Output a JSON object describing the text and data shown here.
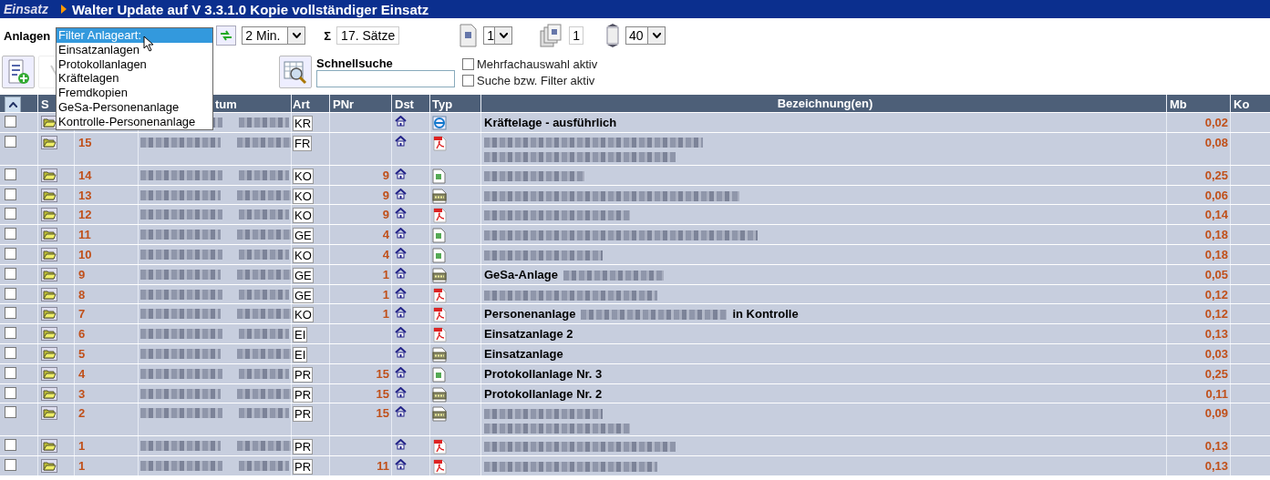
{
  "title_bar": {
    "app": "Einsatz",
    "title": "Walter Update auf V 3.3.1.0 Kopie vollständiger Einsatz"
  },
  "toolbar": {
    "label": "Anlagen",
    "interval": "2 Min.",
    "sigma": "Σ",
    "records": "17. Sätze",
    "page": "1",
    "copies": "1",
    "page_size": "40"
  },
  "filter_dropdown": [
    {
      "label": "Filter Anlageart:",
      "selected": true
    },
    {
      "label": "Einsatzanlagen",
      "selected": false
    },
    {
      "label": "Protokollanlagen",
      "selected": false
    },
    {
      "label": "Kräftelagen",
      "selected": false
    },
    {
      "label": "Fremdkopien",
      "selected": false
    },
    {
      "label": "GeSa-Personenanlage",
      "selected": false
    },
    {
      "label": "Kontrolle-Personenanlage",
      "selected": false
    }
  ],
  "search": {
    "label": "Schnellsuche",
    "options": [
      {
        "label": "Mehrfachauswahl aktiv",
        "checked": false
      },
      {
        "label": "Suche bzw. Filter aktiv",
        "checked": false
      }
    ]
  },
  "table": {
    "columns": [
      "S",
      "tum",
      "Art",
      "PNr",
      "Dst",
      "Typ",
      "Bezeichnung(en)",
      "Mb",
      "Ko"
    ],
    "rows": [
      {
        "checked": false,
        "art": "KR",
        "kind": "web",
        "desc": [
          [
            {
              "kind": "text",
              "text": "Kräftelage - ausführlich"
            }
          ]
        ],
        "mb": "0,02"
      },
      {
        "checked": false,
        "num": "15",
        "art": "FR",
        "kind": "pdf",
        "desc": [
          [
            {
              "kind": "blur"
            }
          ],
          [
            {
              "kind": "blur"
            }
          ]
        ],
        "mb": "0,08"
      },
      {
        "checked": false,
        "num": "14",
        "art": "KO",
        "pnr": "9",
        "kind": "doc",
        "desc": [
          [
            {
              "kind": "blur"
            }
          ]
        ],
        "mb": "0,25"
      },
      {
        "checked": false,
        "num": "13",
        "art": "KO",
        "pnr": "9",
        "kind": "jpg",
        "desc": [
          [
            {
              "kind": "blur"
            }
          ]
        ],
        "mb": "0,06"
      },
      {
        "checked": false,
        "num": "12",
        "art": "KO",
        "pnr": "9",
        "kind": "pdf",
        "desc": [
          [
            {
              "kind": "blur"
            }
          ]
        ],
        "mb": "0,14"
      },
      {
        "checked": false,
        "num": "11",
        "art": "GE",
        "pnr": "4",
        "kind": "doc",
        "desc": [
          [
            {
              "kind": "blur"
            }
          ]
        ],
        "mb": "0,18"
      },
      {
        "checked": false,
        "num": "10",
        "art": "KO",
        "pnr": "4",
        "kind": "doc",
        "desc": [
          [
            {
              "kind": "blur"
            }
          ]
        ],
        "mb": "0,18"
      },
      {
        "checked": false,
        "num": "9",
        "art": "GE",
        "pnr": "1",
        "kind": "jpg",
        "desc": [
          [
            {
              "kind": "text",
              "text": "GeSa-Anlage"
            },
            {
              "kind": "blur"
            }
          ]
        ],
        "mb": "0,05"
      },
      {
        "checked": false,
        "num": "8",
        "art": "GE",
        "pnr": "1",
        "kind": "pdf",
        "desc": [
          [
            {
              "kind": "blur"
            }
          ]
        ],
        "mb": "0,12"
      },
      {
        "checked": false,
        "num": "7",
        "art": "KO",
        "pnr": "1",
        "kind": "pdf",
        "desc": [
          [
            {
              "kind": "text",
              "text": "Personenanlage"
            },
            {
              "kind": "blur"
            },
            {
              "kind": "text",
              "text": "in Kontrolle"
            }
          ]
        ],
        "mb": "0,12"
      },
      {
        "checked": false,
        "num": "6",
        "art": "EI",
        "kind": "pdf",
        "desc": [
          [
            {
              "kind": "text",
              "text": "Einsatzanlage 2"
            }
          ]
        ],
        "mb": "0,13"
      },
      {
        "checked": false,
        "num": "5",
        "art": "EI",
        "kind": "jpg",
        "desc": [
          [
            {
              "kind": "text",
              "text": "Einsatzanlage"
            }
          ]
        ],
        "mb": "0,03"
      },
      {
        "checked": false,
        "num": "4",
        "art": "PR",
        "pnr": "15",
        "kind": "doc",
        "desc": [
          [
            {
              "kind": "text",
              "text": "Protokollanlage Nr. 3"
            }
          ]
        ],
        "mb": "0,25"
      },
      {
        "checked": false,
        "num": "3",
        "art": "PR",
        "pnr": "15",
        "kind": "jpg",
        "desc": [
          [
            {
              "kind": "text",
              "text": "Protokollanlage Nr. 2"
            }
          ]
        ],
        "mb": "0,11"
      },
      {
        "checked": false,
        "num": "2",
        "art": "PR",
        "pnr": "15",
        "kind": "jpg",
        "desc": [
          [
            {
              "kind": "blur"
            }
          ],
          [
            {
              "kind": "blur"
            }
          ]
        ],
        "mb": "0,09"
      },
      {
        "checked": false,
        "num": "1",
        "art": "PR",
        "kind": "pdf",
        "desc": [
          [
            {
              "kind": "blur"
            }
          ]
        ],
        "mb": "0,13"
      },
      {
        "checked": false,
        "num": "1",
        "art": "PR",
        "pnr": "11",
        "kind": "pdf",
        "desc": [
          [
            {
              "kind": "blur"
            }
          ]
        ],
        "mb": "0,13"
      }
    ]
  }
}
